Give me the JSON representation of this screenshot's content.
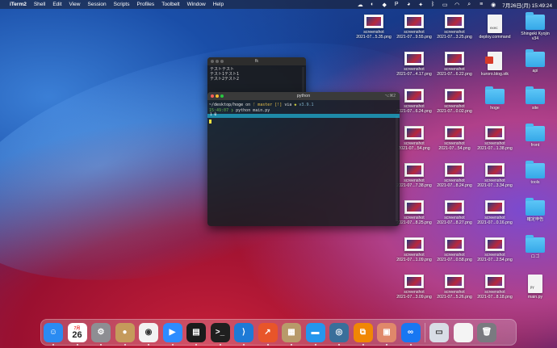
{
  "menubar": {
    "app": "iTerm2",
    "menus": [
      "Shell",
      "Edit",
      "View",
      "Session",
      "Scripts",
      "Profiles",
      "Toolbelt",
      "Window",
      "Help"
    ],
    "clock": "7月26日(月) 15:49:24"
  },
  "desktop_icons": [
    {
      "label": "screenshot\n2021-07...5.35.png",
      "kind": "screenshot"
    },
    {
      "label": "screenshot\n2021-07...9.55.png",
      "kind": "screenshot"
    },
    {
      "label": "screenshot\n2021-07...3.25.png",
      "kind": "screenshot"
    },
    {
      "label": "deploy.command",
      "kind": "doc",
      "tag": "exec"
    },
    {
      "label": "Shingeki Kyojin\nv34",
      "kind": "folder"
    },
    {
      "label": "screenshot\n2021-07...4.17.png",
      "kind": "screenshot"
    },
    {
      "label": "screenshot\n2021-07...6.22.png",
      "kind": "screenshot"
    },
    {
      "label": "kuroro.blog.stk",
      "kind": "docred"
    },
    {
      "label": "api",
      "kind": "folder"
    },
    {
      "label": "screenshot\n2021-07...6.24.png",
      "kind": "screenshot"
    },
    {
      "label": "screenshot\n2021-07...0.02.png",
      "kind": "screenshot"
    },
    {
      "label": "hoge",
      "kind": "folder"
    },
    {
      "label": "site",
      "kind": "folder"
    },
    {
      "label": "screenshot\n2021-07...54.png",
      "kind": "screenshot"
    },
    {
      "label": "screenshot\n2021-07...54.png",
      "kind": "screenshot"
    },
    {
      "label": "screenshot\n2021-07...1.38.png",
      "kind": "screenshot"
    },
    {
      "label": "front",
      "kind": "folder"
    },
    {
      "label": "screenshot\n2021-07...7.38.png",
      "kind": "screenshot"
    },
    {
      "label": "screenshot\n2021-07...8.24.png",
      "kind": "screenshot"
    },
    {
      "label": "screenshot\n2021-07...3.34.png",
      "kind": "screenshot"
    },
    {
      "label": "tools",
      "kind": "folder"
    },
    {
      "label": "screenshot\n2021-07...8.25.png",
      "kind": "screenshot"
    },
    {
      "label": "screenshot\n2021-07...8.27.png",
      "kind": "screenshot"
    },
    {
      "label": "screenshot\n2021-07...0.16.png",
      "kind": "screenshot"
    },
    {
      "label": "確定申告",
      "kind": "folder"
    },
    {
      "label": "screenshot\n2021-07...1.09.png",
      "kind": "screenshot"
    },
    {
      "label": "screenshot\n2021-07...0.58.png",
      "kind": "screenshot"
    },
    {
      "label": "screenshot\n2021-07...2.54.png",
      "kind": "screenshot"
    },
    {
      "label": "ロゴ",
      "kind": "folder"
    },
    {
      "label": "screenshot\n2021-07...3.09.png",
      "kind": "screenshot"
    },
    {
      "label": "screenshot\n2021-07...5.26.png",
      "kind": "screenshot"
    },
    {
      "label": "screenshot\n2021-07...8.18.png",
      "kind": "screenshot"
    },
    {
      "label": "main.py",
      "kind": "doc",
      "tag": "PY"
    }
  ],
  "small_window": {
    "title": "fk",
    "lines": [
      "テストテスト",
      "テスト1テスト1",
      "テスト2テスト2"
    ]
  },
  "main_window": {
    "title": "python",
    "title_right": "⌥⌘2",
    "prompt_path": "~/desktop/hoge",
    "prompt_on": " on ",
    "prompt_branch": "master [!]",
    "prompt_via": " via ",
    "prompt_py": "v3.9.1",
    "time": "15:49:07",
    "command": "python main.py",
    "highlight": "1 0"
  },
  "dock": {
    "apps": [
      {
        "name": "finder",
        "color": "#2a8bf2",
        "glyph": "☺"
      },
      {
        "name": "calendar",
        "day": "26",
        "month": "7月"
      },
      {
        "name": "system-preferences",
        "color": "#8e8e93",
        "glyph": "⚙"
      },
      {
        "name": "contacts",
        "color": "#c59a5b",
        "glyph": "●"
      },
      {
        "name": "chrome",
        "color": "#f2f2f2",
        "glyph": "◉"
      },
      {
        "name": "zoom",
        "color": "#2d8cff",
        "glyph": "▶"
      },
      {
        "name": "activity-monitor",
        "color": "#1b1b1b",
        "glyph": "▤"
      },
      {
        "name": "terminal",
        "color": "#1f1f1f",
        "glyph": ">_"
      },
      {
        "name": "vscode",
        "color": "#1e7ad6",
        "glyph": "⟩"
      },
      {
        "name": "keynote",
        "color": "#e8552a",
        "glyph": "↗"
      },
      {
        "name": "archive-utility",
        "color": "#b89a6a",
        "glyph": "▦"
      },
      {
        "name": "docker",
        "color": "#2496ed",
        "glyph": "▬"
      },
      {
        "name": "quicktime",
        "color": "#3a6f9a",
        "glyph": "◎"
      },
      {
        "name": "drawio",
        "color": "#f08705",
        "glyph": "⧉"
      },
      {
        "name": "photo-app",
        "color": "#e0886a",
        "glyph": "▣"
      },
      {
        "name": "infinity-app",
        "color": "#1877f2",
        "glyph": "∞"
      }
    ],
    "recent": [
      {
        "name": "screenshot-stack",
        "color": "#d8dde6",
        "glyph": "▭"
      },
      {
        "name": "document",
        "color": "#f4f4f4",
        "glyph": ""
      },
      {
        "name": "trash",
        "color": "#7a7a80",
        "glyph": "🗑"
      }
    ]
  }
}
